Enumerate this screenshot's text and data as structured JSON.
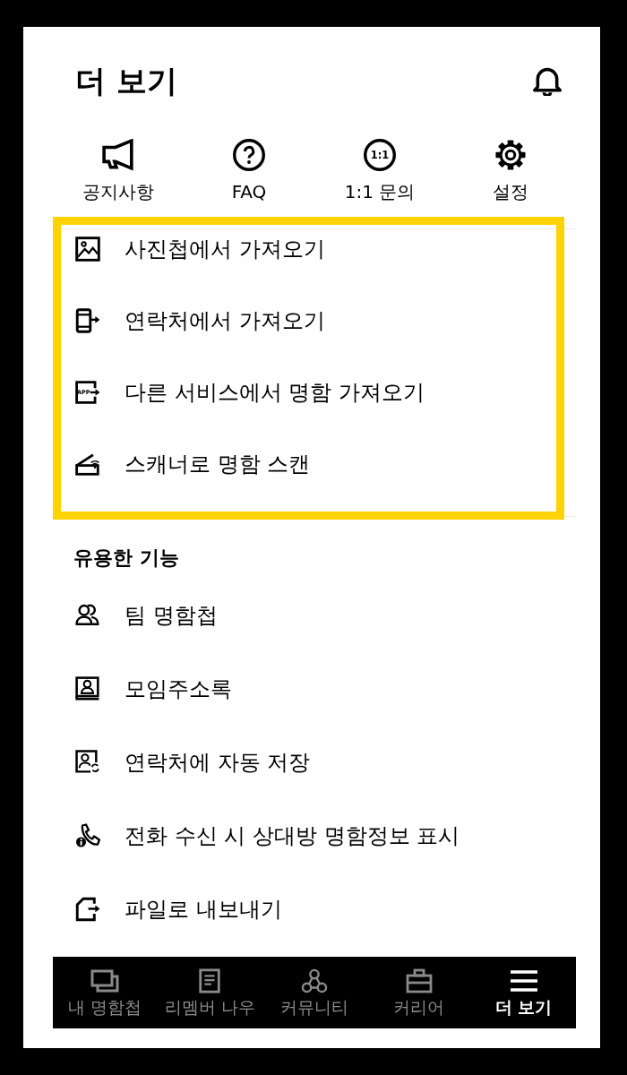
{
  "header": {
    "title": "더 보기"
  },
  "quick_actions": [
    {
      "kind": "notice",
      "label": "공지사항"
    },
    {
      "kind": "faq",
      "label": "FAQ"
    },
    {
      "kind": "inquiry",
      "icon_text": "1:1",
      "label": "1:1 문의"
    },
    {
      "kind": "settings",
      "label": "설정"
    }
  ],
  "import_section": {
    "highlighted": true,
    "items": [
      {
        "kind": "photo",
        "label": "사진첩에서 가져오기"
      },
      {
        "kind": "contacts",
        "label": "연락처에서 가져오기"
      },
      {
        "kind": "app",
        "icon_text": "APP",
        "label": "다른 서비스에서 명함 가져오기"
      },
      {
        "kind": "scanner",
        "label": "스캐너로 명함 스캔"
      }
    ]
  },
  "useful_section": {
    "title": "유용한 기능",
    "items": [
      {
        "kind": "team",
        "label": "팀 명함첩"
      },
      {
        "kind": "address_book",
        "label": "모임주소록"
      },
      {
        "kind": "auto_save",
        "label": "연락처에 자동 저장"
      },
      {
        "kind": "caller_info",
        "label": "전화 수신 시 상대방 명함정보 표시"
      },
      {
        "kind": "export",
        "label": "파일로 내보내기"
      }
    ]
  },
  "bottom_nav": [
    {
      "kind": "cards",
      "label": "내 명함첩",
      "selected": false
    },
    {
      "kind": "now",
      "label": "리멤버 나우",
      "selected": false
    },
    {
      "kind": "community",
      "label": "커뮤니티",
      "selected": false
    },
    {
      "kind": "career",
      "label": "커리어",
      "selected": false
    },
    {
      "kind": "more",
      "label": "더 보기",
      "selected": true
    }
  ]
}
